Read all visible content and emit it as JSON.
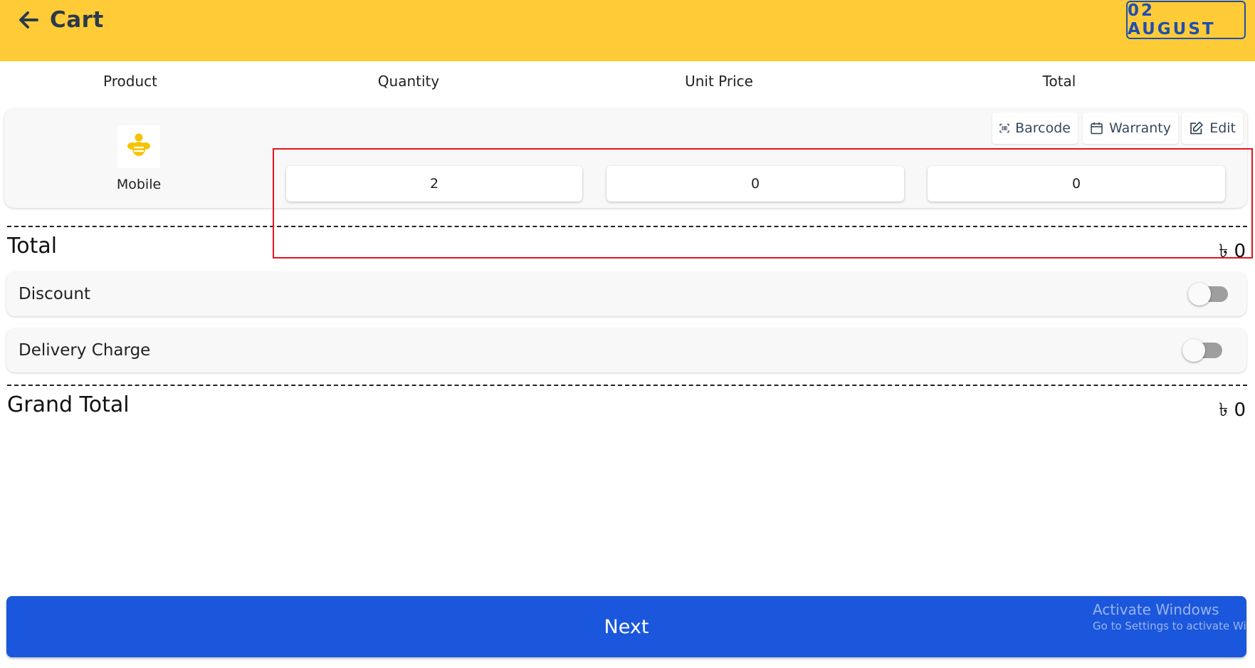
{
  "header": {
    "title": "Cart",
    "date_label": "02 AUGUST",
    "bg_color": "#ffcb37"
  },
  "columns": [
    "Product",
    "Quantity",
    "Unit Price",
    "Total"
  ],
  "item": {
    "name": "Mobile",
    "icon": "bee-logo-icon",
    "actions": [
      {
        "label": "Barcode",
        "icon": "barcode-icon"
      },
      {
        "label": "Warranty",
        "icon": "calendar-icon"
      },
      {
        "label": "Edit",
        "icon": "edit-icon"
      }
    ],
    "quantity": "2",
    "unit_price": "0",
    "total": "0"
  },
  "summary": {
    "total_label": "Total",
    "total_value": "৳ 0",
    "discount_label": "Discount",
    "discount_enabled": false,
    "delivery_label": "Delivery Charge",
    "delivery_enabled": false,
    "grand_total_label": "Grand Total",
    "grand_total_value": "৳ 0"
  },
  "next_label": "Next",
  "watermark": {
    "line1": "Activate Windows",
    "line2": "Go to Settings to activate Windo"
  },
  "accent_color": "#1b57dc"
}
